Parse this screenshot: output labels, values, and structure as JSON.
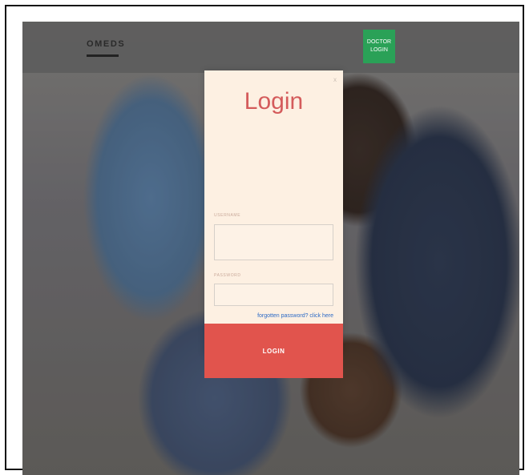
{
  "header": {
    "brand": "OMEDS",
    "doctor_login_line1": "DOCTOR",
    "doctor_login_line2": "LOGIN"
  },
  "modal": {
    "title": "Login",
    "close_glyph": "x",
    "username_label": "USERNAME",
    "username_value": "",
    "password_label": "PASSWORD",
    "password_value": "",
    "forgot_link": "forgotten password? click here",
    "login_button": "LOGIN"
  },
  "colors": {
    "accent_red": "#e1544d",
    "title_red": "#d45b5b",
    "doctor_green": "#2aa157",
    "modal_bg": "#fdf0e2",
    "link_blue": "#2b69c6"
  },
  "icons": {
    "close": "close-icon"
  }
}
